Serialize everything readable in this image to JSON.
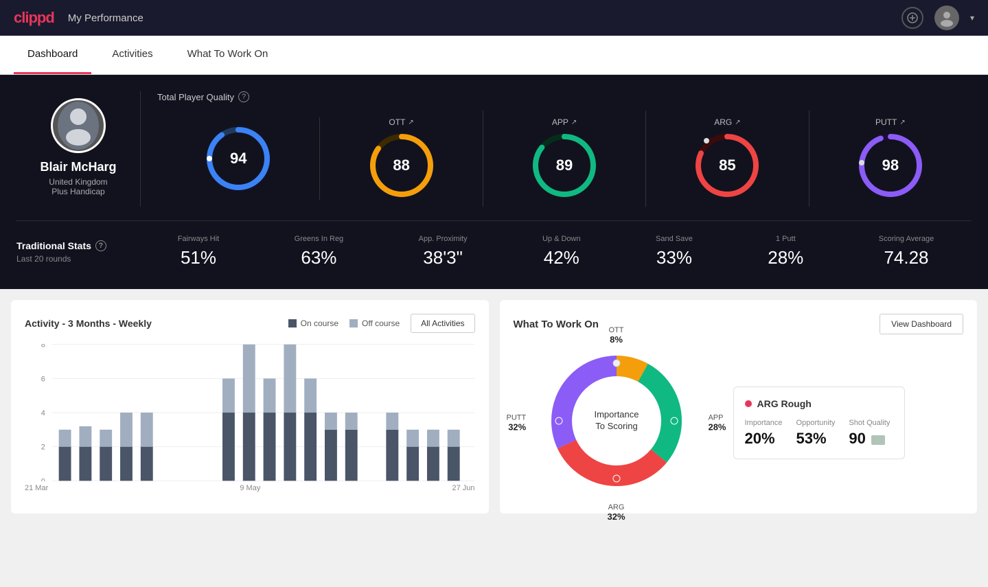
{
  "app": {
    "logo": "clippd",
    "nav_title": "My Performance"
  },
  "tabs": [
    {
      "id": "dashboard",
      "label": "Dashboard",
      "active": true
    },
    {
      "id": "activities",
      "label": "Activities",
      "active": false
    },
    {
      "id": "what_to_work_on",
      "label": "What To Work On",
      "active": false
    }
  ],
  "player": {
    "name": "Blair McHarg",
    "country": "United Kingdom",
    "handicap": "Plus Handicap"
  },
  "total_quality": {
    "label": "Total Player Quality",
    "value": 94,
    "color": "#3b82f6"
  },
  "quality_metrics": [
    {
      "id": "ott",
      "label": "OTT",
      "value": 88,
      "color": "#f59e0b"
    },
    {
      "id": "app",
      "label": "APP",
      "value": 89,
      "color": "#10b981"
    },
    {
      "id": "arg",
      "label": "ARG",
      "value": 85,
      "color": "#ef4444"
    },
    {
      "id": "putt",
      "label": "PUTT",
      "value": 98,
      "color": "#8b5cf6"
    }
  ],
  "traditional_stats": {
    "label": "Traditional Stats",
    "subtitle": "Last 20 rounds",
    "metrics": [
      {
        "label": "Fairways Hit",
        "value": "51%"
      },
      {
        "label": "Greens In Reg",
        "value": "63%"
      },
      {
        "label": "App. Proximity",
        "value": "38'3\""
      },
      {
        "label": "Up & Down",
        "value": "42%"
      },
      {
        "label": "Sand Save",
        "value": "33%"
      },
      {
        "label": "1 Putt",
        "value": "28%"
      },
      {
        "label": "Scoring Average",
        "value": "74.28"
      }
    ]
  },
  "activity_chart": {
    "title": "Activity - 3 Months - Weekly",
    "legend": [
      {
        "label": "On course",
        "color": "#4a5568"
      },
      {
        "label": "Off course",
        "color": "#a0aec0"
      }
    ],
    "all_activities_btn": "All Activities",
    "x_labels": [
      "21 Mar",
      "9 May",
      "27 Jun"
    ],
    "y_labels": [
      "0",
      "2",
      "4",
      "6",
      "8"
    ]
  },
  "what_to_work_on": {
    "title": "What To Work On",
    "view_dashboard_btn": "View Dashboard",
    "donut_center": "Importance\nTo Scoring",
    "segments": [
      {
        "label": "OTT",
        "pct": "8%",
        "color": "#f59e0b"
      },
      {
        "label": "APP",
        "pct": "28%",
        "color": "#10b981"
      },
      {
        "label": "ARG",
        "pct": "32%",
        "color": "#ef4444"
      },
      {
        "label": "PUTT",
        "pct": "32%",
        "color": "#8b5cf6"
      }
    ],
    "info_card": {
      "title": "ARG Rough",
      "dot_color": "#e8355a",
      "metrics": [
        {
          "label": "Importance",
          "value": "20%"
        },
        {
          "label": "Opportunity",
          "value": "53%"
        },
        {
          "label": "Shot Quality",
          "value": "90"
        }
      ]
    }
  }
}
